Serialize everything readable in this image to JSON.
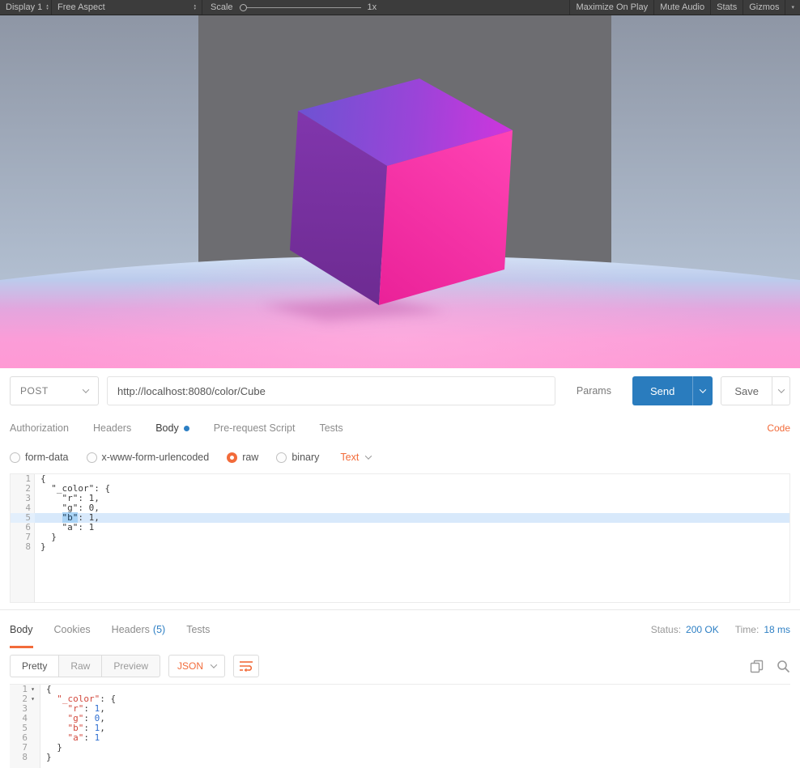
{
  "unity_toolbar": {
    "display": "Display 1",
    "aspect": "Free Aspect",
    "scale_label": "Scale",
    "scale_value": "1x",
    "maximize_label": "Maximize On Play",
    "mute_label": "Mute Audio",
    "stats_label": "Stats",
    "gizmos_label": "Gizmos"
  },
  "scene": {
    "object": "magenta-cube"
  },
  "colors": {
    "accent_orange": "#f26b3a",
    "send_blue": "#2a7cbe",
    "link_blue": "#2d7fc4",
    "json_key_red": "#d2483c",
    "json_value_blue": "#2f6fd0",
    "cube_top_left": "#6d53d2",
    "cube_top_right": "#cf35dd",
    "cube_left_face": "#7a33a4",
    "cube_front_face": "#f42aa2",
    "floor_pink": "#ff9ad6",
    "floor_blue": "#cfe2f6",
    "wall_gray": "#6d6d71"
  },
  "request": {
    "method": "POST",
    "url": "http://localhost:8080/color/Cube",
    "params_label": "Params",
    "send_label": "Send",
    "save_label": "Save",
    "code_link": "Code",
    "tabs": [
      {
        "label": "Authorization"
      },
      {
        "label": "Headers"
      },
      {
        "label": "Body",
        "active": true,
        "dot": true
      },
      {
        "label": "Pre-request Script"
      },
      {
        "label": "Tests"
      }
    ],
    "body_modes": [
      {
        "label": "form-data"
      },
      {
        "label": "x-www-form-urlencoded"
      },
      {
        "label": "raw",
        "selected": true
      },
      {
        "label": "binary"
      }
    ],
    "format_label": "Text",
    "editor": {
      "highlight_line": 5,
      "lines": [
        {
          "tokens": [
            [
              "p",
              "{"
            ]
          ]
        },
        {
          "tokens": [
            [
              "p",
              "  \"_color\": {"
            ]
          ]
        },
        {
          "tokens": [
            [
              "p",
              "    \"r\": 1,"
            ]
          ]
        },
        {
          "tokens": [
            [
              "p",
              "    \"g\": 0,"
            ]
          ]
        },
        {
          "tokens": [
            [
              "p",
              "    "
            ],
            [
              "sel",
              "\"b\""
            ],
            [
              "p",
              ": 1,"
            ]
          ]
        },
        {
          "tokens": [
            [
              "p",
              "    \"a\": 1"
            ]
          ]
        },
        {
          "tokens": [
            [
              "p",
              "  }"
            ]
          ]
        },
        {
          "tokens": [
            [
              "p",
              "}"
            ]
          ]
        }
      ]
    }
  },
  "response": {
    "tabs": [
      {
        "label": "Body",
        "active": true
      },
      {
        "label": "Cookies"
      },
      {
        "label": "Headers",
        "count": "(5)"
      },
      {
        "label": "Tests"
      }
    ],
    "status_label": "Status:",
    "status_value": "200 OK",
    "time_label": "Time:",
    "time_value": "18 ms",
    "view_tabs": [
      {
        "label": "Pretty",
        "active": true
      },
      {
        "label": "Raw"
      },
      {
        "label": "Preview"
      }
    ],
    "format_label": "JSON",
    "editor": {
      "lines": [
        {
          "fold": true,
          "tokens": [
            [
              "p",
              "{"
            ]
          ]
        },
        {
          "fold": true,
          "tokens": [
            [
              "p",
              "  "
            ],
            [
              "k",
              "\"_color\""
            ],
            [
              "p",
              ": {"
            ]
          ]
        },
        {
          "tokens": [
            [
              "p",
              "    "
            ],
            [
              "k",
              "\"r\""
            ],
            [
              "p",
              ": "
            ],
            [
              "v",
              "1"
            ],
            [
              "p",
              ","
            ]
          ]
        },
        {
          "tokens": [
            [
              "p",
              "    "
            ],
            [
              "k",
              "\"g\""
            ],
            [
              "p",
              ": "
            ],
            [
              "v",
              "0"
            ],
            [
              "p",
              ","
            ]
          ]
        },
        {
          "tokens": [
            [
              "p",
              "    "
            ],
            [
              "k",
              "\"b\""
            ],
            [
              "p",
              ": "
            ],
            [
              "v",
              "1"
            ],
            [
              "p",
              ","
            ]
          ]
        },
        {
          "tokens": [
            [
              "p",
              "    "
            ],
            [
              "k",
              "\"a\""
            ],
            [
              "p",
              ": "
            ],
            [
              "v",
              "1"
            ]
          ]
        },
        {
          "tokens": [
            [
              "p",
              "  }"
            ]
          ]
        },
        {
          "tokens": [
            [
              "p",
              "}"
            ]
          ]
        }
      ]
    }
  }
}
